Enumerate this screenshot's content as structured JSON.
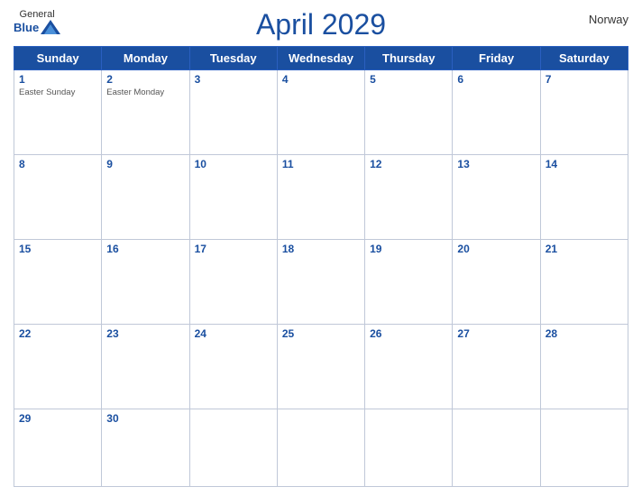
{
  "header": {
    "title_month": "April 2029",
    "country": "Norway",
    "logo": {
      "general": "General",
      "blue": "Blue"
    }
  },
  "weekdays": [
    "Sunday",
    "Monday",
    "Tuesday",
    "Wednesday",
    "Thursday",
    "Friday",
    "Saturday"
  ],
  "weeks": [
    [
      {
        "num": "1",
        "holiday": "Easter Sunday"
      },
      {
        "num": "2",
        "holiday": "Easter Monday"
      },
      {
        "num": "3",
        "holiday": ""
      },
      {
        "num": "4",
        "holiday": ""
      },
      {
        "num": "5",
        "holiday": ""
      },
      {
        "num": "6",
        "holiday": ""
      },
      {
        "num": "7",
        "holiday": ""
      }
    ],
    [
      {
        "num": "8",
        "holiday": ""
      },
      {
        "num": "9",
        "holiday": ""
      },
      {
        "num": "10",
        "holiday": ""
      },
      {
        "num": "11",
        "holiday": ""
      },
      {
        "num": "12",
        "holiday": ""
      },
      {
        "num": "13",
        "holiday": ""
      },
      {
        "num": "14",
        "holiday": ""
      }
    ],
    [
      {
        "num": "15",
        "holiday": ""
      },
      {
        "num": "16",
        "holiday": ""
      },
      {
        "num": "17",
        "holiday": ""
      },
      {
        "num": "18",
        "holiday": ""
      },
      {
        "num": "19",
        "holiday": ""
      },
      {
        "num": "20",
        "holiday": ""
      },
      {
        "num": "21",
        "holiday": ""
      }
    ],
    [
      {
        "num": "22",
        "holiday": ""
      },
      {
        "num": "23",
        "holiday": ""
      },
      {
        "num": "24",
        "holiday": ""
      },
      {
        "num": "25",
        "holiday": ""
      },
      {
        "num": "26",
        "holiday": ""
      },
      {
        "num": "27",
        "holiday": ""
      },
      {
        "num": "28",
        "holiday": ""
      }
    ],
    [
      {
        "num": "29",
        "holiday": ""
      },
      {
        "num": "30",
        "holiday": ""
      },
      {
        "num": "",
        "holiday": ""
      },
      {
        "num": "",
        "holiday": ""
      },
      {
        "num": "",
        "holiday": ""
      },
      {
        "num": "",
        "holiday": ""
      },
      {
        "num": "",
        "holiday": ""
      }
    ]
  ],
  "colors": {
    "header_bg": "#1a4fa0",
    "accent": "#1a4fa0"
  }
}
